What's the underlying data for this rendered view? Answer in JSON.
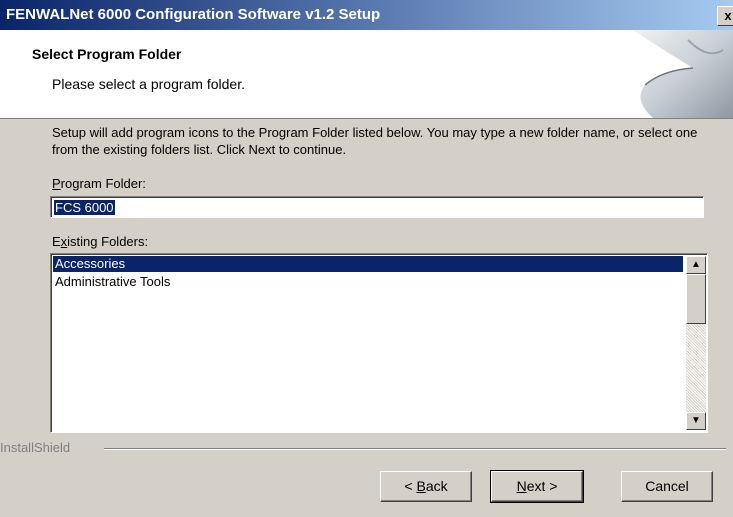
{
  "window": {
    "title": "FENWALNet 6000 Configuration Software v1.2 Setup",
    "close_label": "x"
  },
  "header": {
    "title": "Select Program Folder",
    "subtitle": "Please select a program folder."
  },
  "description": "Setup will add program icons to the Program Folder listed below.  You may type a new folder name, or select one from the existing folders list.  Click Next to continue.",
  "program_folder": {
    "label_prefix": "",
    "label_underline": "P",
    "label_rest": "rogram Folder:",
    "value": "FCS 6000"
  },
  "existing_folders": {
    "label_prefix": "E",
    "label_underline": "x",
    "label_rest": "isting Folders:",
    "items": [
      "Accessories",
      "Administrative Tools"
    ],
    "selected_index": 0,
    "scroll_up": "▲",
    "scroll_down": "▼"
  },
  "brand": "InstallShield",
  "buttons": {
    "back_prefix": "< ",
    "back_underline": "B",
    "back_rest": "ack",
    "next_underline": "N",
    "next_rest": "ext >",
    "cancel": "Cancel"
  }
}
